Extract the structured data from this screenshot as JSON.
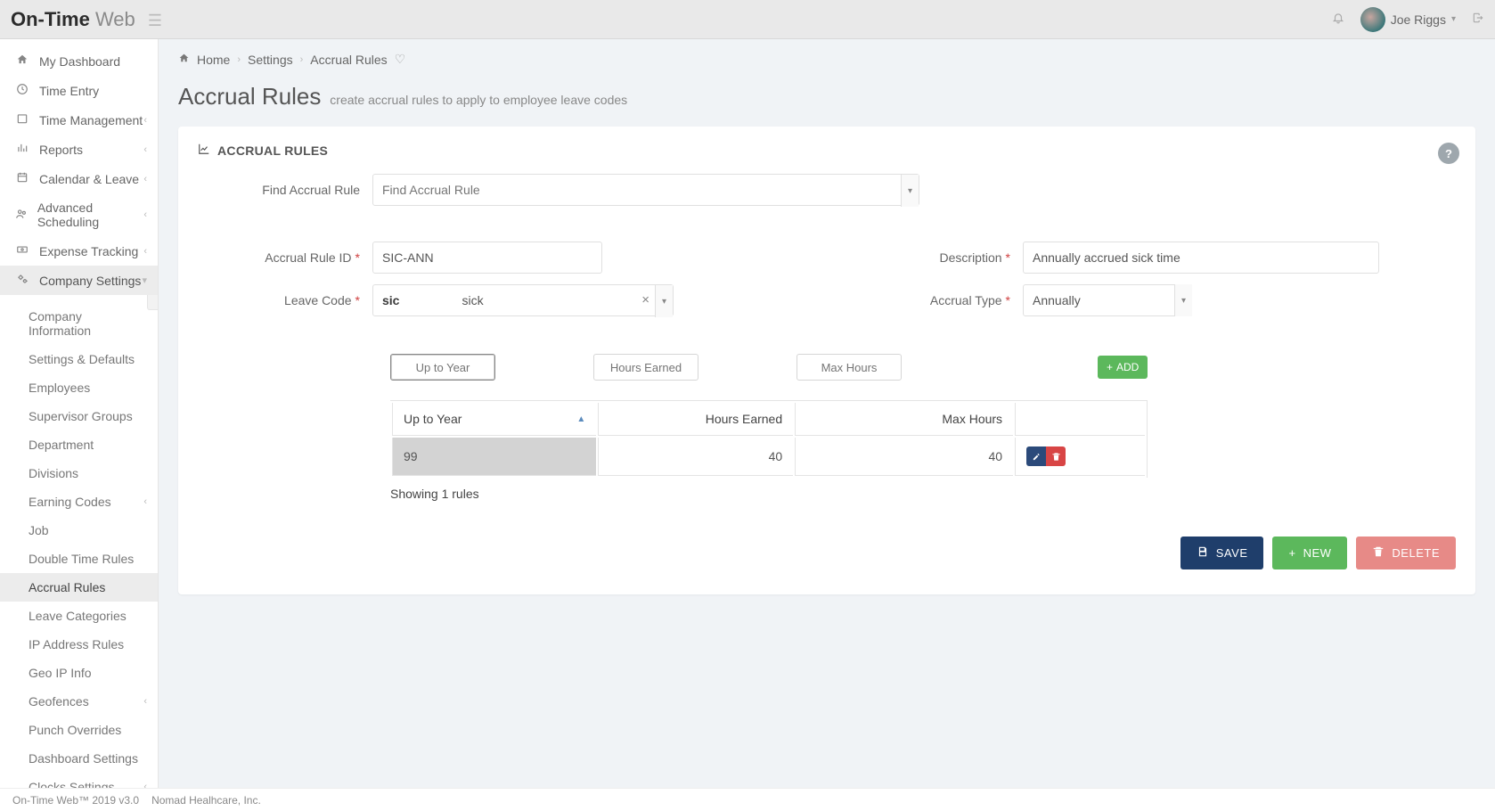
{
  "brand": {
    "part1": "On-Time",
    "part2": " Web"
  },
  "user": {
    "name": "Joe Riggs"
  },
  "breadcrumbs": {
    "home": "Home",
    "mid": "Settings",
    "leaf": "Accrual Rules"
  },
  "page": {
    "title": "Accrual Rules",
    "subtitle": "create accrual rules to apply to employee leave codes"
  },
  "panel": {
    "title": "ACCRUAL RULES"
  },
  "sidebar": {
    "items": [
      {
        "label": "My Dashboard",
        "icon": "home-icon"
      },
      {
        "label": "Time Entry",
        "icon": "clock-icon"
      },
      {
        "label": "Time Management",
        "icon": "calendar-box-icon",
        "expandable": true
      },
      {
        "label": "Reports",
        "icon": "bars-icon",
        "expandable": true
      },
      {
        "label": "Calendar & Leave",
        "icon": "calendar-icon",
        "expandable": true
      },
      {
        "label": "Advanced Scheduling",
        "icon": "people-icon",
        "expandable": true
      },
      {
        "label": "Expense Tracking",
        "icon": "money-icon",
        "expandable": true
      },
      {
        "label": "Company Settings",
        "icon": "cogs-icon",
        "expandable": true,
        "open": true
      }
    ],
    "subitems": [
      {
        "label": "Company Information"
      },
      {
        "label": "Settings & Defaults"
      },
      {
        "label": "Employees"
      },
      {
        "label": "Supervisor Groups"
      },
      {
        "label": "Department"
      },
      {
        "label": "Divisions"
      },
      {
        "label": "Earning Codes",
        "expandable": true
      },
      {
        "label": "Job"
      },
      {
        "label": "Double Time Rules"
      },
      {
        "label": "Accrual Rules",
        "active": true
      },
      {
        "label": "Leave Categories"
      },
      {
        "label": "IP Address Rules"
      },
      {
        "label": "Geo IP Info"
      },
      {
        "label": "Geofences",
        "expandable": true
      },
      {
        "label": "Punch Overrides"
      },
      {
        "label": "Dashboard Settings"
      },
      {
        "label": "Clocks Settings",
        "expandable": true
      }
    ]
  },
  "form": {
    "find_label": "Find Accrual Rule",
    "find_placeholder": "Find Accrual Rule",
    "rule_id_label": "Accrual Rule ID",
    "rule_id_value": "SIC-ANN",
    "description_label": "Description",
    "description_value": "Annually accrued sick time",
    "leave_code_label": "Leave Code",
    "leave_code_value_code": "sic",
    "leave_code_value_desc": "sick",
    "accrual_type_label": "Accrual Type",
    "accrual_type_value": "Annually"
  },
  "tiers": {
    "input_up_to_year_placeholder": "Up to Year",
    "input_hours_earned_placeholder": "Hours Earned",
    "input_max_hours_placeholder": "Max Hours",
    "add_label": "ADD",
    "columns": [
      "Up to Year",
      "Hours Earned",
      "Max Hours"
    ],
    "rows": [
      {
        "up_to_year": "99",
        "hours_earned": "40",
        "max_hours": "40"
      }
    ],
    "showing": "Showing 1 rules"
  },
  "buttons": {
    "save": "SAVE",
    "new": "NEW",
    "delete": "DELETE"
  },
  "footer": {
    "ver": "On-Time Web™ 2019 v3.0",
    "co": "Nomad Healhcare, Inc."
  }
}
